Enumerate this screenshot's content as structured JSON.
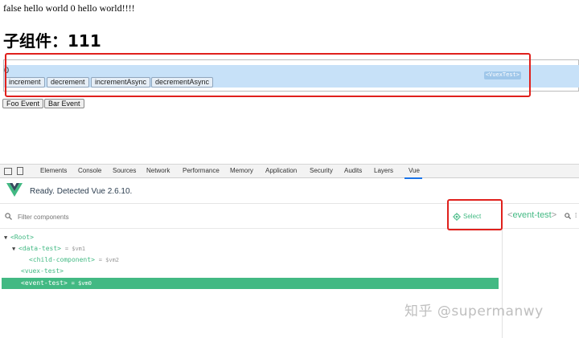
{
  "page": {
    "line1": "false hello world 0 hello world!!!!",
    "heading": "子组件：111",
    "count": "0",
    "store_buttons": [
      "increment",
      "decrement",
      "incrementAsync",
      "decrementAsync"
    ],
    "vuex_tag": "<VuexTest>",
    "event_buttons": [
      "Foo Event",
      "Bar Event"
    ]
  },
  "devtools": {
    "tabs": [
      "Elements",
      "Console",
      "Sources",
      "Network",
      "Performance",
      "Memory",
      "Application",
      "Security",
      "Audits",
      "Layers",
      "Vue"
    ],
    "active_tab": "Vue",
    "ready_text": "Ready. Detected Vue 2.6.10.",
    "filter_placeholder": "Filter components",
    "select_label": "Select",
    "inspect_title": "event-test",
    "tree": [
      {
        "label": "<Root>",
        "arrow": "▼",
        "vm": ""
      },
      {
        "label": "<data-test>",
        "arrow": "▼",
        "vm": "= $vm1"
      },
      {
        "label": "<child-component>",
        "arrow": "",
        "vm": "= $vm2"
      },
      {
        "label": "<vuex-test>",
        "arrow": "",
        "vm": ""
      },
      {
        "label": "<event-test>",
        "arrow": "",
        "vm": "= $vm0"
      }
    ]
  },
  "watermark": "知乎 @supermanwy",
  "colors": {
    "vue_green": "#42b983",
    "highlight_blue": "#c7e1f8",
    "annotation_red": "#e0201c"
  }
}
